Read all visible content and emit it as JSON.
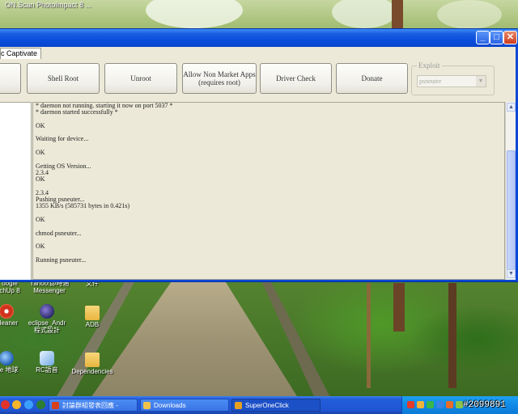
{
  "desktop": {
    "top_text": "ON.Scan  PhotoImpact 8  ...                        ",
    "icons": [
      {
        "name": "sketchup",
        "label": "chUp 8",
        "top_label": "oogle"
      },
      {
        "name": "messenger",
        "label": "Messenger",
        "top_label": "Yahoo!即時通"
      },
      {
        "name": "top-doc",
        "label": "文件",
        "top_label": ""
      },
      {
        "name": "cleaner",
        "label": "Cleaner"
      },
      {
        "name": "eclipse",
        "label": "eclipse_Andr\n程式設計"
      },
      {
        "name": "adb-folder",
        "label": "ADB"
      },
      {
        "name": "google-earth",
        "label": "gle 地球"
      },
      {
        "name": "rc",
        "label": "RC語音"
      },
      {
        "name": "dependencies",
        "label": "Dependencies"
      }
    ]
  },
  "window": {
    "title": "",
    "controls": {
      "minimize": "_",
      "maximize": "□",
      "close": "✕"
    },
    "tab_label": "c Captivate",
    "toolbar": {
      "shell_root": "Shell Root",
      "unroot": "Unroot",
      "allow_non_market_line1": "Allow Non Market Apps",
      "allow_non_market_line2": "(requires root)",
      "driver_check": "Driver Check",
      "donate": "Donate"
    },
    "exploit": {
      "label": "Exploit",
      "selected": "psneuter"
    },
    "console_lines": [
      "* daemon not running. starting it now on port 5037 *",
      "* daemon started successfully *",
      "",
      "OK",
      "",
      "Waiting for device...",
      "",
      "OK",
      "",
      "Getting OS Version...",
      "2.3.4",
      "OK",
      "",
      "2.3.4",
      "Pushing psneuter...",
      "1355 KB/s (585731 bytes in 0.421s)",
      "",
      "OK",
      "",
      "chmod psneuter...",
      "",
      "OK",
      "",
      "Running psneuter..."
    ]
  },
  "taskbar": {
    "buttons": [
      {
        "label": "討論群組發表回應 -",
        "color": "#d7401c"
      },
      {
        "label": "Downloads",
        "color": "#f0c24b"
      },
      {
        "label": "SuperOneClick",
        "color": "#e6a020"
      }
    ],
    "watermark": "#2099891",
    "tray_icon_colors": [
      "#e23b2b",
      "#f3b33a",
      "#3bb54a",
      "#3b82e2",
      "#e96b2b",
      "#8bc34a",
      "#f06292"
    ]
  }
}
